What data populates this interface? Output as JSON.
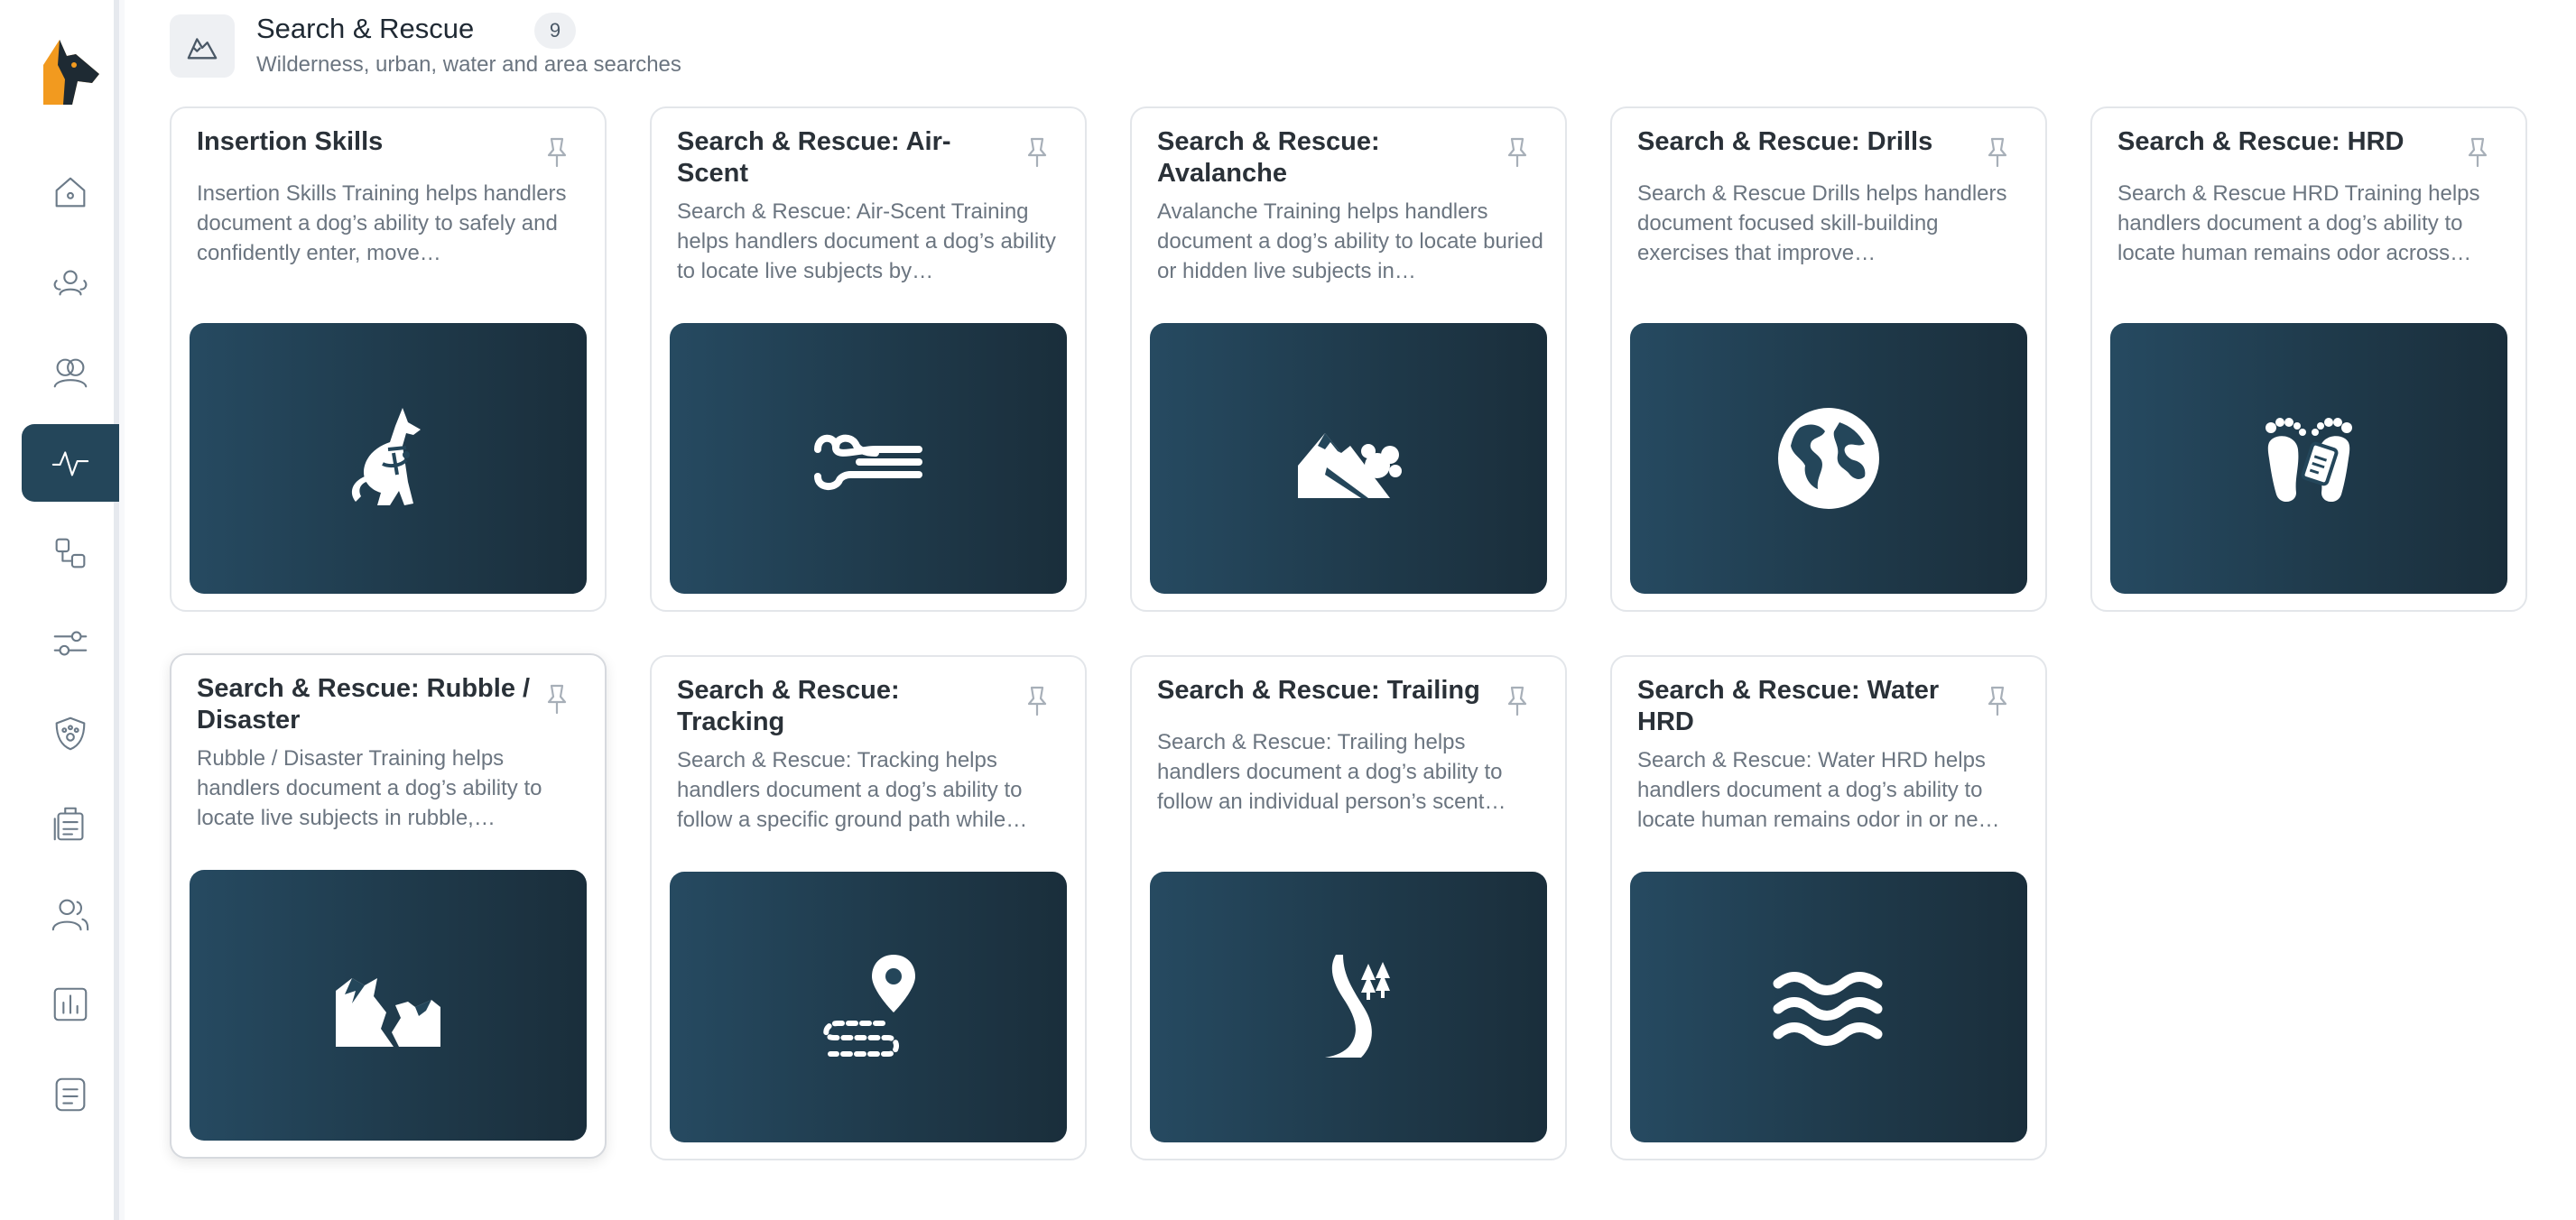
{
  "section": {
    "title": "Search & Rescue",
    "count": "9",
    "subtitle": "Wilderness, urban, water and area searches"
  },
  "nav": [
    "home-icon",
    "team-icon",
    "groups-icon",
    "activity-icon",
    "workflow-icon",
    "settings-sliders-icon",
    "paw-shield-icon",
    "records-icon",
    "people-icon",
    "reports-icon",
    "notes-icon"
  ],
  "cards": [
    {
      "title": "Insertion Skills",
      "description": "Insertion Skills Training helps handlers document a dog’s ability to safely and confidently enter, move…",
      "icon": "harness-dog-icon"
    },
    {
      "title": "Search & Rescue: Air-Scent",
      "description": "Search & Rescue: Air-Scent Training helps handlers document a dog’s ability to locate live subjects by…",
      "icon": "wind-icon"
    },
    {
      "title": "Search & Rescue: Avalanche",
      "description": "Avalanche Training helps handlers document a dog’s ability to locate buried or hidden live subjects in…",
      "icon": "avalanche-icon"
    },
    {
      "title": "Search & Rescue: Drills",
      "description": "Search & Rescue Drills helps handlers document focused skill-building exercises that improve…",
      "icon": "globe-icon"
    },
    {
      "title": "Search & Rescue: HRD",
      "description": "Search & Rescue HRD Training helps handlers document a dog’s ability to locate human remains odor across…",
      "icon": "feet-tag-icon"
    },
    {
      "title": "Search & Rescue: Rubble / Disaster",
      "description": "Rubble / Disaster Training helps handlers document a dog’s ability to locate live subjects in rubble,…",
      "icon": "earthquake-icon"
    },
    {
      "title": "Search & Rescue: Tracking",
      "description": "Search & Rescue: Tracking helps handlers document a dog’s ability to follow a specific ground path while…",
      "icon": "route-pin-icon"
    },
    {
      "title": "Search & Rescue: Trailing",
      "description": "Search & Rescue: Trailing helps handlers document a dog’s ability to follow an individual person’s scent…",
      "icon": "trail-trees-icon"
    },
    {
      "title": "Search & Rescue: Water HRD",
      "description": "Search & Rescue: Water HRD helps handlers document a dog’s ability to locate human remains odor in or ne…",
      "icon": "water-waves-icon"
    }
  ],
  "colors": {
    "accent": "#24465a",
    "card_image": "#1f3a4b",
    "logo_orange": "#f29a1f"
  }
}
